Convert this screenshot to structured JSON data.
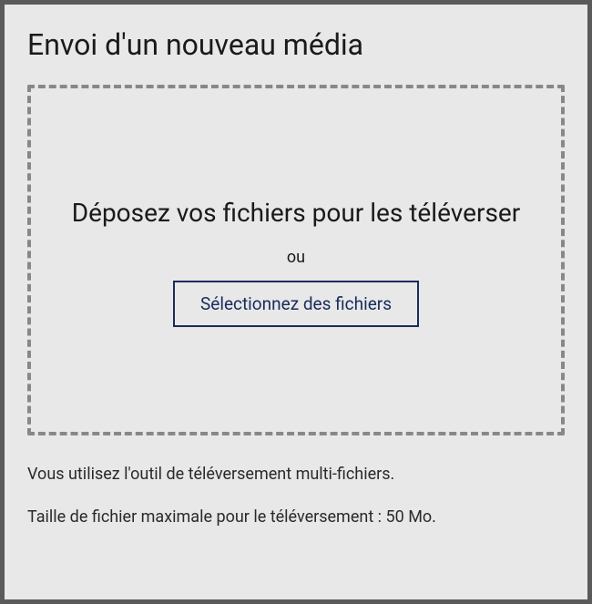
{
  "header": {
    "title": "Envoi d'un nouveau média"
  },
  "dropzone": {
    "drop_text": "Déposez vos fichiers pour les téléverser",
    "or_label": "ou",
    "select_button_label": "Sélectionnez des fichiers"
  },
  "info": {
    "multi_file_text": "Vous utilisez l'outil de téléversement multi-fichiers.",
    "max_size_text": "Taille de fichier maximale pour le téléversement : 50 Mo."
  }
}
